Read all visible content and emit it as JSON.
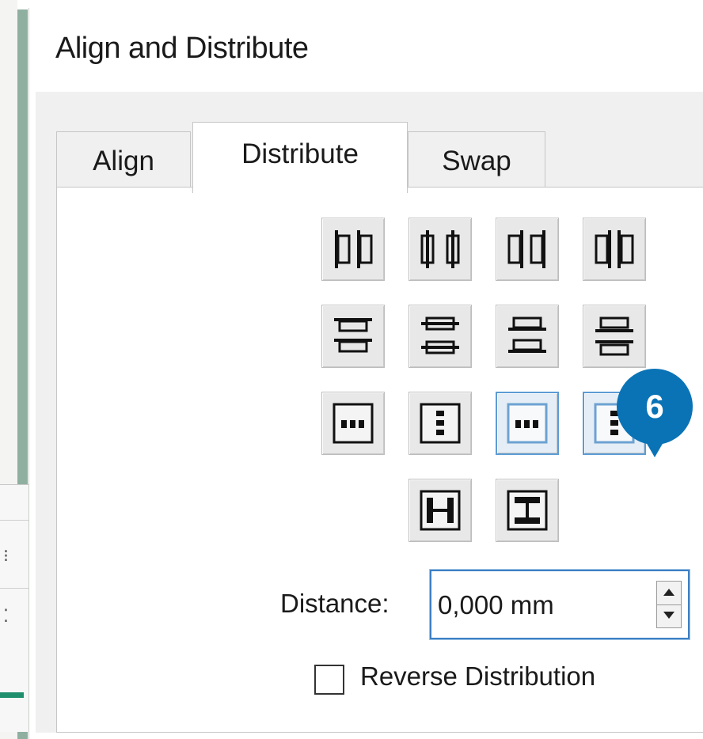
{
  "dialog": {
    "title": "Align and Distribute"
  },
  "tabs": [
    {
      "label": "Align",
      "selected": false
    },
    {
      "label": "Distribute",
      "selected": true
    },
    {
      "label": "Swap",
      "selected": false
    }
  ],
  "distribute_buttons": {
    "row1": [
      "distribute-left-edges-icon",
      "distribute-horizontal-centers-icon",
      "distribute-right-edges-icon",
      "distribute-horizontal-gaps-icon"
    ],
    "row2": [
      "distribute-top-edges-icon",
      "distribute-vertical-centers-icon",
      "distribute-bottom-edges-icon",
      "distribute-vertical-gaps-icon"
    ],
    "row3": [
      "distance-horizontal-icon",
      "distance-vertical-icon",
      "distance-horizontal-active-icon",
      "distance-vertical-active-icon"
    ],
    "row4": [
      "make-horizontal-gaps-equal-icon",
      "make-vertical-gaps-equal-icon"
    ]
  },
  "distance": {
    "label": "Distance:",
    "value": "0,000 mm"
  },
  "reverse": {
    "label": "Reverse Distribution",
    "checked": false
  },
  "callout": {
    "number": "6",
    "color": "#0a73b6"
  },
  "colors": {
    "active_border": "#5d9bd4",
    "focus_border": "#3d7fc4"
  }
}
